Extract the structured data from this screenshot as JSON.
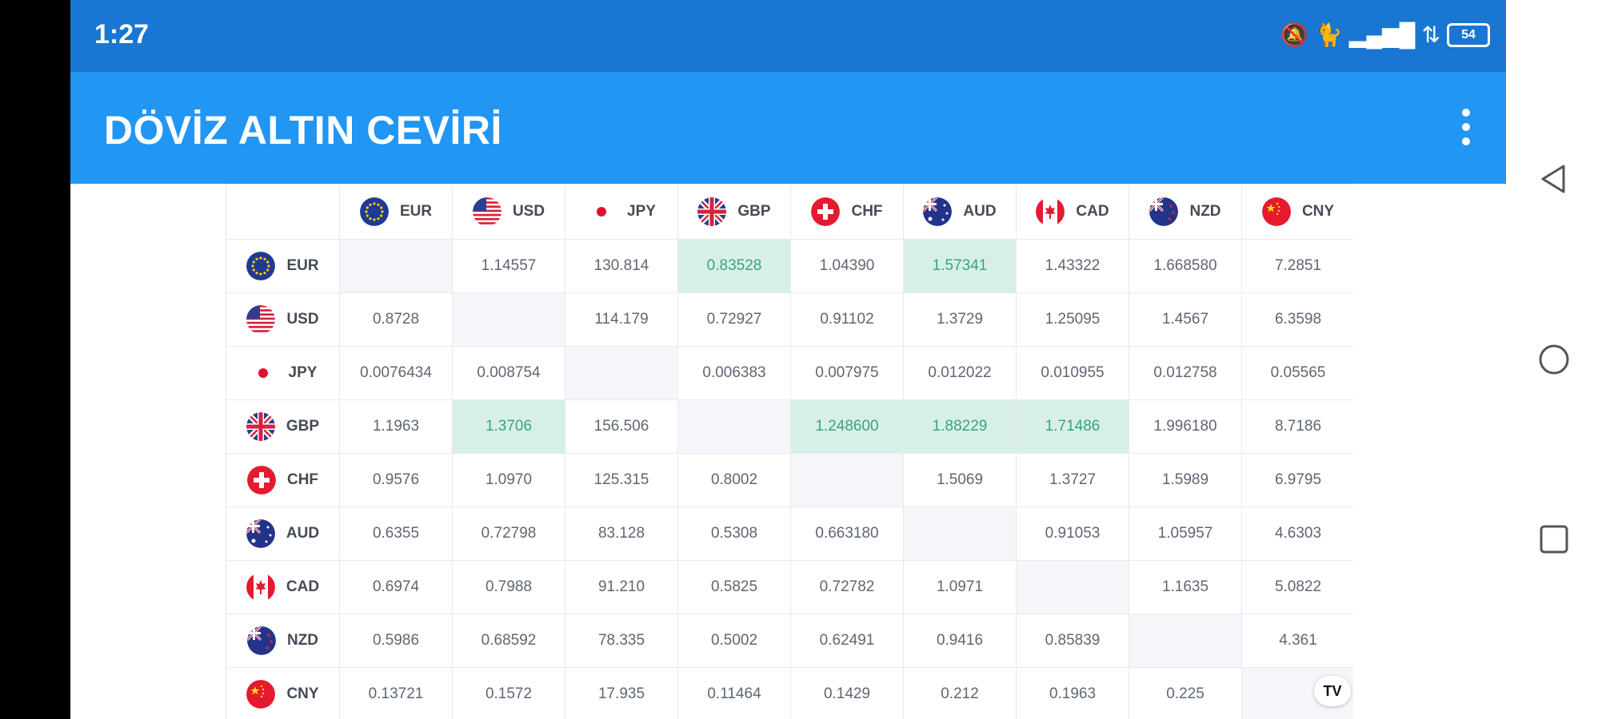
{
  "status_bar": {
    "time": "1:27",
    "battery": "54"
  },
  "app_bar": {
    "title": "DÖVİZ ALTIN CEVİRİ"
  },
  "table": {
    "currencies": [
      "EUR",
      "USD",
      "JPY",
      "GBP",
      "CHF",
      "AUD",
      "CAD",
      "NZD",
      "CNY"
    ],
    "rows": [
      {
        "code": "EUR",
        "cells": [
          "",
          "1.14557",
          "130.814",
          "0.83528",
          "1.04390",
          "1.57341",
          "1.43322",
          "1.668580",
          "7.2851"
        ]
      },
      {
        "code": "USD",
        "cells": [
          "0.8728",
          "",
          "114.179",
          "0.72927",
          "0.91102",
          "1.3729",
          "1.25095",
          "1.4567",
          "6.3598"
        ]
      },
      {
        "code": "JPY",
        "cells": [
          "0.0076434",
          "0.008754",
          "",
          "0.006383",
          "0.007975",
          "0.012022",
          "0.010955",
          "0.012758",
          "0.05565"
        ]
      },
      {
        "code": "GBP",
        "cells": [
          "1.1963",
          "1.3706",
          "156.506",
          "",
          "1.248600",
          "1.88229",
          "1.71486",
          "1.996180",
          "8.7186"
        ]
      },
      {
        "code": "CHF",
        "cells": [
          "0.9576",
          "1.0970",
          "125.315",
          "0.8002",
          "",
          "1.5069",
          "1.3727",
          "1.5989",
          "6.9795"
        ]
      },
      {
        "code": "AUD",
        "cells": [
          "0.6355",
          "0.72798",
          "83.128",
          "0.5308",
          "0.663180",
          "",
          "0.91053",
          "1.05957",
          "4.6303"
        ]
      },
      {
        "code": "CAD",
        "cells": [
          "0.6974",
          "0.7988",
          "91.210",
          "0.5825",
          "0.72782",
          "1.0971",
          "",
          "1.1635",
          "5.0822"
        ]
      },
      {
        "code": "NZD",
        "cells": [
          "0.5986",
          "0.68592",
          "78.335",
          "0.5002",
          "0.62491",
          "0.9416",
          "0.85839",
          "",
          "4.361"
        ]
      },
      {
        "code": "CNY",
        "cells": [
          "0.13721",
          "0.1572",
          "17.935",
          "0.11464",
          "0.1429",
          "0.212",
          "0.1963",
          "0.225",
          ""
        ]
      }
    ],
    "highlighted": [
      [
        0,
        3
      ],
      [
        0,
        5
      ],
      [
        3,
        1
      ],
      [
        3,
        4
      ],
      [
        3,
        5
      ],
      [
        3,
        6
      ]
    ],
    "colors": {
      "highlight_bg": "#d8efe7",
      "highlight_text": "#38a57e",
      "appbar": "#2196f3",
      "statusbar": "#1976d2"
    }
  },
  "badge": {
    "text": "TV"
  }
}
